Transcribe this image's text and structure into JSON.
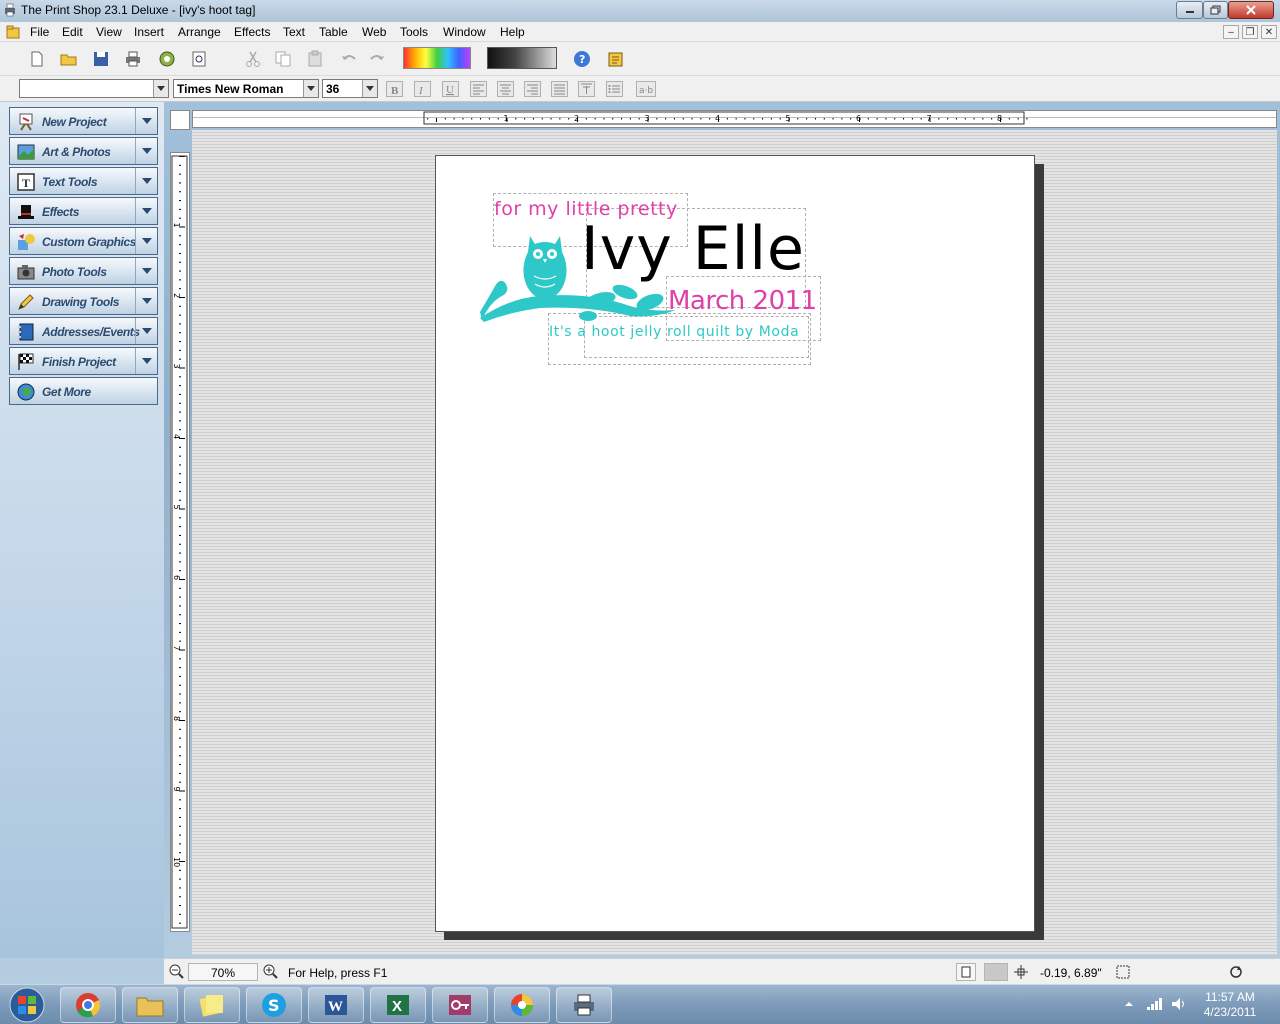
{
  "window": {
    "title": "The Print Shop 23.1 Deluxe - [ivy's hoot tag]"
  },
  "menu": [
    "File",
    "Edit",
    "View",
    "Insert",
    "Arrange",
    "Effects",
    "Text",
    "Table",
    "Web",
    "Tools",
    "Window",
    "Help"
  ],
  "toolbar": {
    "buttons": [
      "new-document-icon",
      "open-folder-icon",
      "save-icon",
      "print-icon",
      "print-preview-icon",
      "zoom-page-icon",
      "cut-icon",
      "copy-icon",
      "paste-icon",
      "undo-icon",
      "redo-icon",
      "color-palette",
      "gradient-palette",
      "help-icon",
      "notes-icon"
    ]
  },
  "format": {
    "style_value": "",
    "font_value": "Times New Roman",
    "size_value": "36",
    "buttons": [
      "bold-icon",
      "italic-icon",
      "underline-icon",
      "align-left-icon",
      "align-center-icon",
      "align-right-icon",
      "justify-icon",
      "top-align-icon",
      "bullet-list-icon",
      "char-spacing-icon"
    ]
  },
  "panel": {
    "items": [
      {
        "label": "New Project",
        "icon": "easel-icon"
      },
      {
        "label": "Art & Photos",
        "icon": "photo-icon"
      },
      {
        "label": "Text Tools",
        "icon": "text-icon"
      },
      {
        "label": "Effects",
        "icon": "magic-hat-icon"
      },
      {
        "label": "Custom Graphics",
        "icon": "graphics-icon"
      },
      {
        "label": "Photo Tools",
        "icon": "camera-icon"
      },
      {
        "label": "Drawing Tools",
        "icon": "pencil-icon"
      },
      {
        "label": "Addresses/Events",
        "icon": "address-book-icon"
      },
      {
        "label": "Finish Project",
        "icon": "checkered-flag-icon"
      },
      {
        "label": "Get More",
        "icon": "globe-icon"
      }
    ]
  },
  "ruler": {
    "h_labels": [
      "1",
      "2",
      "3",
      "4",
      "5",
      "6",
      "7",
      "8"
    ],
    "v_labels": [
      "1",
      "2",
      "3",
      "4",
      "5",
      "6",
      "7",
      "8",
      "9",
      "10"
    ]
  },
  "canvas": {
    "line1": "for my little pretty",
    "line2": "Ivy Elle",
    "line3": "March 2011",
    "line4": "It's a hoot jelly roll quilt by Moda",
    "colors": {
      "pink": "#e040a8",
      "teal": "#2ec8c8",
      "black": "#000000"
    }
  },
  "status": {
    "zoom": "70%",
    "help": "For Help, press F1",
    "coords": "-0.19, 6.89\""
  },
  "taskbar": {
    "time": "11:57 AM",
    "date": "4/23/2011"
  }
}
